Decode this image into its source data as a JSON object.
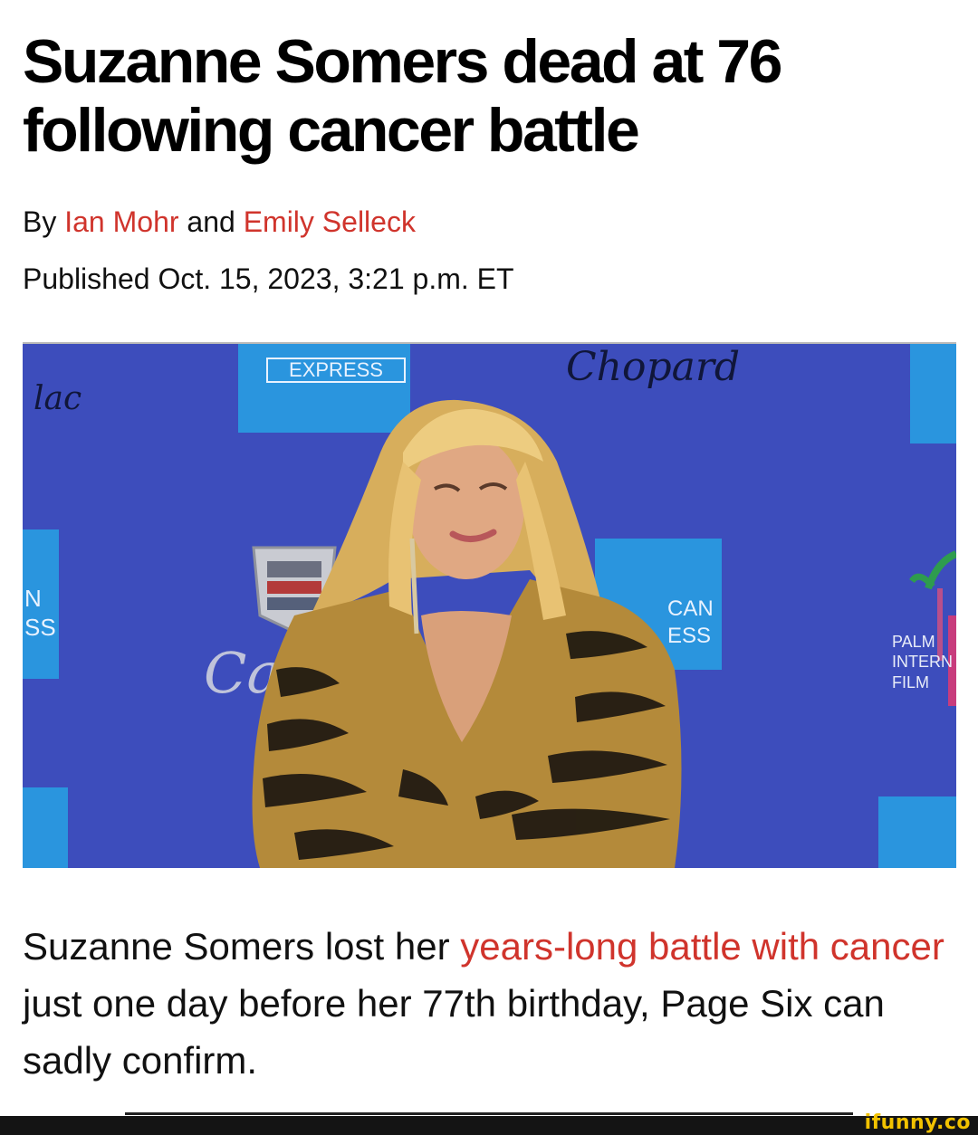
{
  "article": {
    "headline": "Suzanne Somers dead at 76 following cancer battle",
    "byline_prefix": "By",
    "author_1": "Ian Mohr",
    "byline_joiner": "and",
    "author_2": "Emily Selleck",
    "published": "Published Oct. 15, 2023, 3:21 p.m. ET",
    "body_before_link": "Suzanne Somers lost her ",
    "body_link": "years-long battle with cancer",
    "body_after_link": " just one day before her 77th birthday, Page Six can sadly confirm."
  },
  "photo": {
    "backdrop_text": {
      "express": "EXPRESS",
      "chopard": "Chopard",
      "lac": "lac",
      "n": "N",
      "ss": "SS",
      "can": "CAN",
      "ess": "ESS",
      "ca": "Ca",
      "palm": "PALM",
      "intern": "INTERN",
      "film": "FILM"
    },
    "colors": {
      "backdrop": "#3a49b8",
      "amex_blue": "#1e88d8",
      "hair": "#e6c070",
      "skin": "#d9a07a",
      "dress_gold": "#b48a3a",
      "dress_black": "#1a1510"
    }
  },
  "footer": {
    "watermark": "ifunny.co"
  },
  "colors": {
    "link": "#d0342c",
    "text": "#111111"
  }
}
